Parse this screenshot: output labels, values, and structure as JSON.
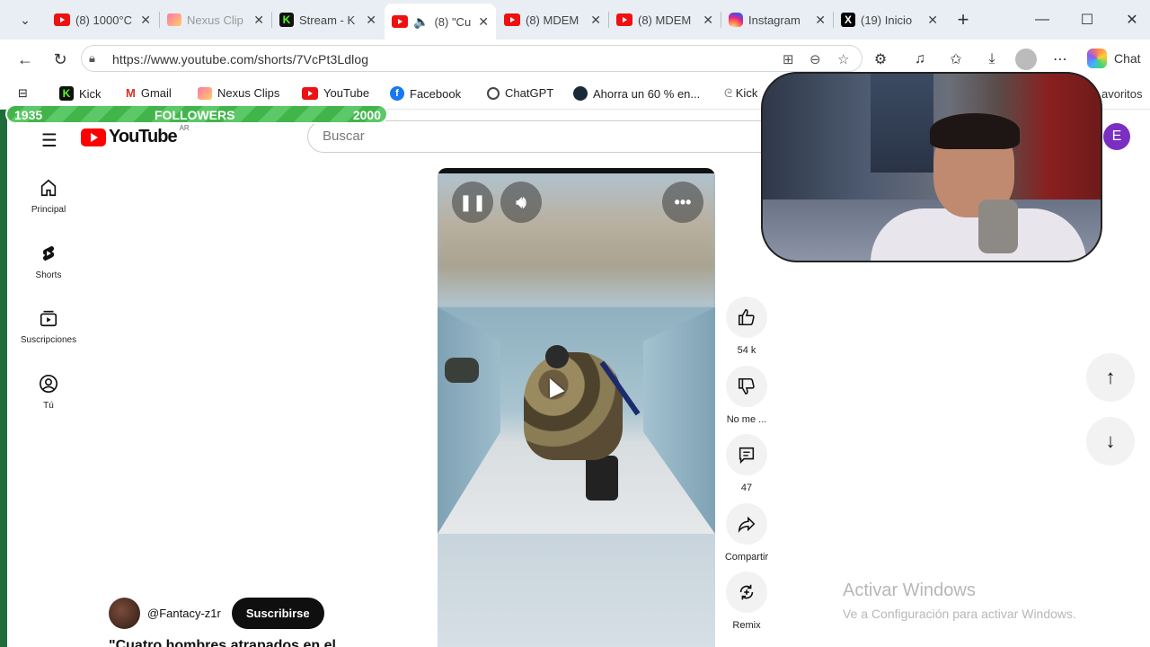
{
  "browser": {
    "tabs": [
      {
        "title": "(8) 1000°C",
        "icon": "youtube-icon",
        "active": false
      },
      {
        "title": "Nexus Clip",
        "icon": "nexus-icon",
        "active": false
      },
      {
        "title": "Stream - K",
        "icon": "kick-icon",
        "active": false
      },
      {
        "title": "(8) \"Cu",
        "icon": "youtube-icon",
        "active": true,
        "audio": true
      },
      {
        "title": "(8) MDEM",
        "icon": "youtube-icon",
        "active": false
      },
      {
        "title": "(8) MDEM",
        "icon": "youtube-icon",
        "active": false
      },
      {
        "title": "Instagram",
        "icon": "instagram-icon",
        "active": false
      },
      {
        "title": "(19) Inicio",
        "icon": "x-icon",
        "active": false
      }
    ],
    "url": "https://www.youtube.com/shorts/7VcPt3Ldlog",
    "chat_label": "Chat",
    "bookmarks": [
      {
        "label": "Kick",
        "icon": "kick-icon"
      },
      {
        "label": "Gmail",
        "icon": "gmail-icon"
      },
      {
        "label": "Nexus Clips",
        "icon": "nexus-icon"
      },
      {
        "label": "YouTube",
        "icon": "youtube-icon"
      },
      {
        "label": "Facebook",
        "icon": "facebook-icon"
      },
      {
        "label": "ChatGPT",
        "icon": "chatgpt-icon"
      },
      {
        "label": "Ahorra un 60 % en...",
        "icon": "steam-icon"
      }
    ],
    "bookmark_partial": "Kick",
    "bookmark_favorites_partial": "avoritos"
  },
  "followers_goal": {
    "current": "1935",
    "label": "FOLLOWERS",
    "goal": "2000",
    "progress": 0.9675
  },
  "youtube": {
    "logo_text": "YouTube",
    "logo_country": "AR",
    "search_placeholder": "Buscar",
    "user_initial": "E",
    "sidebar": [
      {
        "label": "Principal",
        "icon": "home-icon"
      },
      {
        "label": "Shorts",
        "icon": "shorts-icon"
      },
      {
        "label": "Suscripciones",
        "icon": "subscriptions-icon"
      },
      {
        "label": "Tú",
        "icon": "you-icon"
      }
    ],
    "actions": {
      "like_count": "54 k",
      "dislike_label": "No me ...",
      "comments_count": "47",
      "share_label": "Compartir",
      "remix_label": "Remix"
    },
    "channel_handle": "@Fantacy-z1r",
    "subscribe_label": "Suscribirse",
    "video_title_partial": "\"Cuatro hombres atrapados en el"
  },
  "windows_watermark": {
    "line1": "Activar Windows",
    "line2": "Ve a Configuración para activar Windows."
  },
  "colors": {
    "youtube_red": "#ff0000",
    "followers_green": "#41b54a",
    "avatar_purple": "#7b2fc2"
  }
}
